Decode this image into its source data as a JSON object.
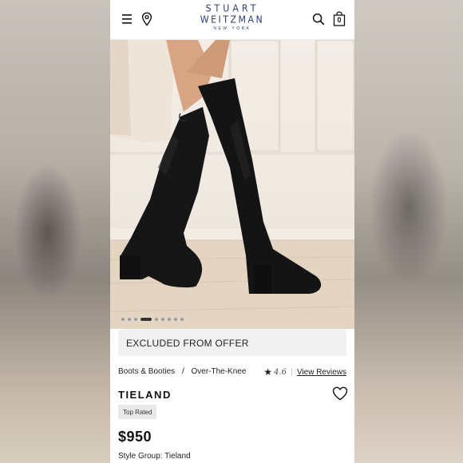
{
  "header": {
    "brand_line1": "STUART",
    "brand_line2": "WEITZMAN",
    "brand_line3": "NEW YORK",
    "cart_count": "0",
    "brand_color": "#2a3f78",
    "icons": [
      "menu-icon",
      "location-pin-icon",
      "search-icon",
      "shopping-bag-icon"
    ]
  },
  "gallery": {
    "image_count": 9,
    "active_index": 3
  },
  "offer_banner": {
    "label": "EXCLUDED FROM OFFER"
  },
  "breadcrumb": {
    "items": [
      "Boots & Booties",
      "Over-The-Knee"
    ],
    "separator": "/"
  },
  "rating": {
    "value": "4.6",
    "reviews_link": "View Reviews"
  },
  "product": {
    "name": "TIELAND",
    "badge": "Top Rated",
    "price": "$950",
    "style_group": "Style Group: Tieland"
  }
}
